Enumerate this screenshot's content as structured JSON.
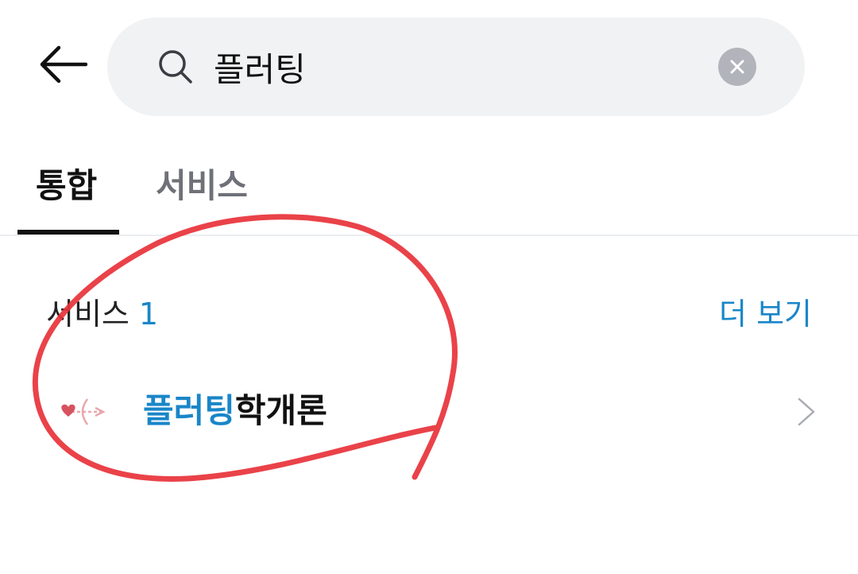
{
  "header": {
    "back_icon": "arrow-left-icon"
  },
  "search": {
    "query": "플러팅",
    "search_icon": "search-icon",
    "clear_icon": "close-icon"
  },
  "tabs": [
    {
      "label": "통합",
      "active": true
    },
    {
      "label": "서비스",
      "active": false
    }
  ],
  "services_section": {
    "title": "서비스",
    "count": "1",
    "more_label": "더 보기"
  },
  "results": [
    {
      "title_highlight": "플러팅",
      "title_rest": "학개론",
      "logo_icon": "cupid-arrow-heart-icon",
      "chevron_icon": "chevron-right-icon"
    }
  ],
  "colors": {
    "accent": "#1a86c8",
    "annotation": "#e8323a",
    "search_bg": "#f1f2f4"
  }
}
